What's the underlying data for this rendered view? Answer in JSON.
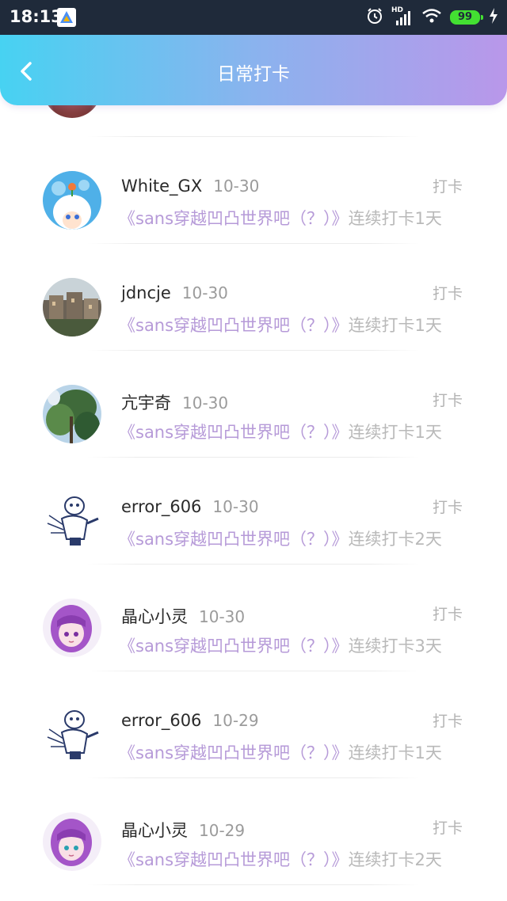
{
  "status_bar": {
    "time": "18:13",
    "network_label": "HD",
    "battery": "99"
  },
  "header": {
    "title": "日常打卡"
  },
  "colors": {
    "header_gradient_start": "#47d2f2",
    "header_gradient_end": "#b997ea",
    "topic_text": "#b69ad8",
    "secondary_text": "#b9b9b9"
  },
  "feed": {
    "items": [
      {
        "username": "White_GX",
        "date": "10-30",
        "action": "打卡",
        "topic": "《sans穿越凹凸世界吧（？）》",
        "streak": "连续打卡1天",
        "avatar_icon": "anime-avatar-icon"
      },
      {
        "username": "jdncje",
        "date": "10-30",
        "action": "打卡",
        "topic": "《sans穿越凹凸世界吧（？）》",
        "streak": "连续打卡1天",
        "avatar_icon": "photo-avatar-icon"
      },
      {
        "username": "亢宇奇",
        "date": "10-30",
        "action": "打卡",
        "topic": "《sans穿越凹凸世界吧（？）》",
        "streak": "连续打卡1天",
        "avatar_icon": "plant-avatar-icon"
      },
      {
        "username": "error_606",
        "date": "10-30",
        "action": "打卡",
        "topic": "《sans穿越凹凸世界吧（？）》",
        "streak": "连续打卡2天",
        "avatar_icon": "skeleton-avatar-icon"
      },
      {
        "username": "晶心小灵",
        "date": "10-30",
        "action": "打卡",
        "topic": "《sans穿越凹凸世界吧（？）》",
        "streak": "连续打卡3天",
        "avatar_icon": "purple-hair-avatar-icon"
      },
      {
        "username": "error_606",
        "date": "10-29",
        "action": "打卡",
        "topic": "《sans穿越凹凸世界吧（？）》",
        "streak": "连续打卡1天",
        "avatar_icon": "skeleton-avatar-icon"
      },
      {
        "username": "晶心小灵",
        "date": "10-29",
        "action": "打卡",
        "topic": "《sans穿越凹凸世界吧（？）》",
        "streak": "连续打卡2天",
        "avatar_icon": "purple-hair-avatar-icon"
      }
    ]
  }
}
